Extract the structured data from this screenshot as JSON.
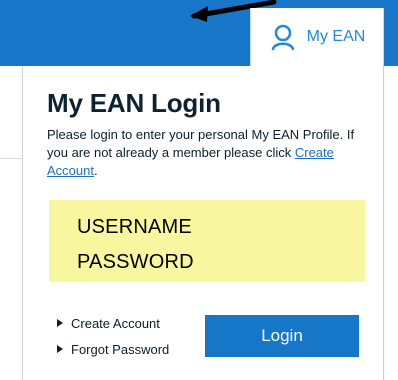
{
  "header": {
    "account_label": "My EAN",
    "icons": {
      "account": "user-outline-icon",
      "annotation": "arrow-annotation-icon"
    },
    "colors": {
      "bar": "#1877c9",
      "accent": "#1f8bd8"
    }
  },
  "login_panel": {
    "title": "My EAN Login",
    "description_prefix": "Please login to enter your personal My EAN Profile. If you are not already a member please click ",
    "create_account_link": "Create Account",
    "description_suffix": ".",
    "credentials": {
      "username_label": "USERNAME",
      "password_label": "PASSWORD",
      "highlight_color": "#f8f7a0"
    },
    "links": [
      {
        "label": "Create Account"
      },
      {
        "label": "Forgot Password"
      }
    ],
    "login_button": "Login"
  }
}
